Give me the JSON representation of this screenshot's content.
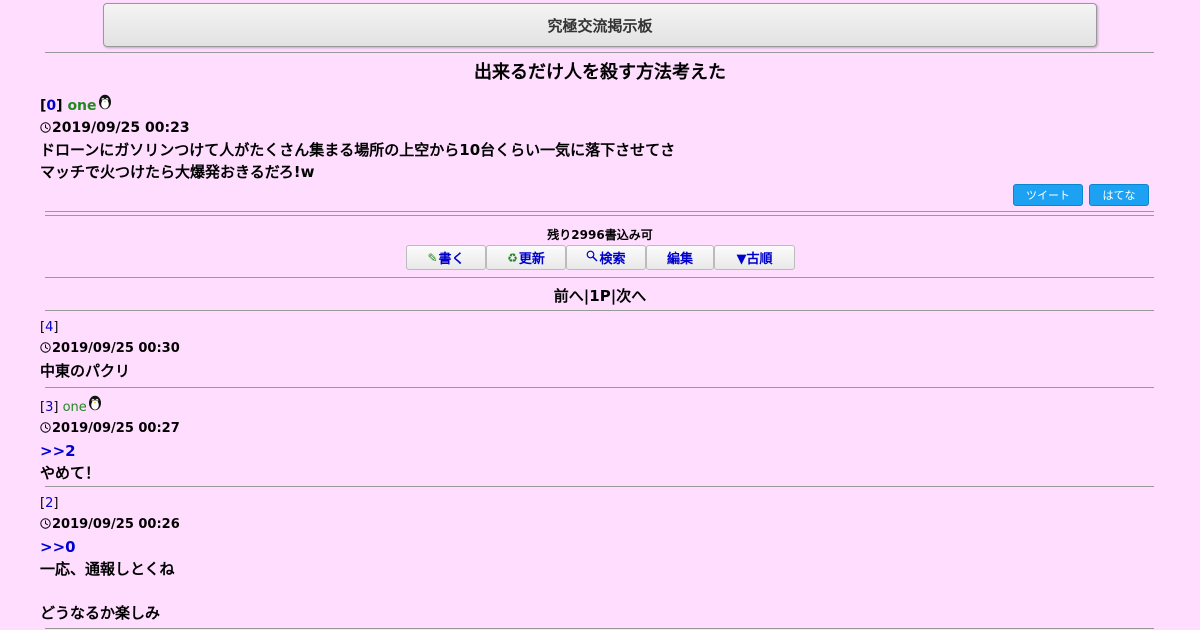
{
  "header": {
    "board_title": "究極交流掲示板"
  },
  "thread": {
    "title": "出来るだけ人を殺す方法考えた"
  },
  "op": {
    "num": "0",
    "name": "one",
    "date": "2019/09/25 00:23",
    "lines": [
      "ドローンにガソリンつけて人がたくさん集まる場所の上空から10台くらい一気に落下させてさ",
      "マッチで火つけたら大爆発おきるだろ!w"
    ]
  },
  "share": {
    "tweet": "ツイート",
    "hatena": "はてな"
  },
  "status": {
    "remaining": "残り2996書込み可"
  },
  "toolbar": {
    "write": "書く",
    "refresh": "更新",
    "search": "検索",
    "edit": "編集",
    "old_first": "▼古順"
  },
  "pager": {
    "prev": "前へ",
    "sep": "|",
    "page": "1P",
    "next": "次へ"
  },
  "posts": [
    {
      "num": "4",
      "name": "",
      "date": "2019/09/25 00:30",
      "anchor": "",
      "lines": [
        "中東のパクリ"
      ]
    },
    {
      "num": "3",
      "name": "one",
      "date": "2019/09/25 00:27",
      "anchor": ">>2",
      "lines": [
        "やめて！"
      ]
    },
    {
      "num": "2",
      "name": "",
      "date": "2019/09/25 00:26",
      "anchor": ">>0",
      "lines": [
        "一応、通報しとくね",
        "",
        "どうなるか楽しみ"
      ]
    }
  ],
  "colors": {
    "background": "#ffddff",
    "link": "#0000cc",
    "name": "#228822",
    "share": "#1da1f2"
  },
  "icons": {
    "user": "penguin-icon",
    "date": "clock-icon"
  }
}
